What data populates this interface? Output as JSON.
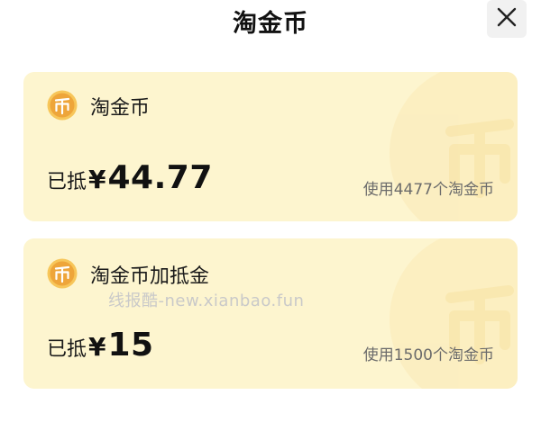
{
  "header": {
    "title": "淘金币"
  },
  "cards": [
    {
      "title": "淘金币",
      "deduct_label": "已抵",
      "currency": "¥",
      "amount": "44.77",
      "usage": "使用4477个淘金币"
    },
    {
      "title": "淘金币加抵金",
      "deduct_label": "已抵",
      "currency": "¥",
      "amount": "15",
      "usage": "使用1500个淘金币"
    }
  ],
  "watermark": "线报酷-new.xianbao.fun",
  "colors": {
    "card_bg": "#fdf5cf",
    "coin": "#f0a93b",
    "close_bg": "#f1f1f1"
  }
}
